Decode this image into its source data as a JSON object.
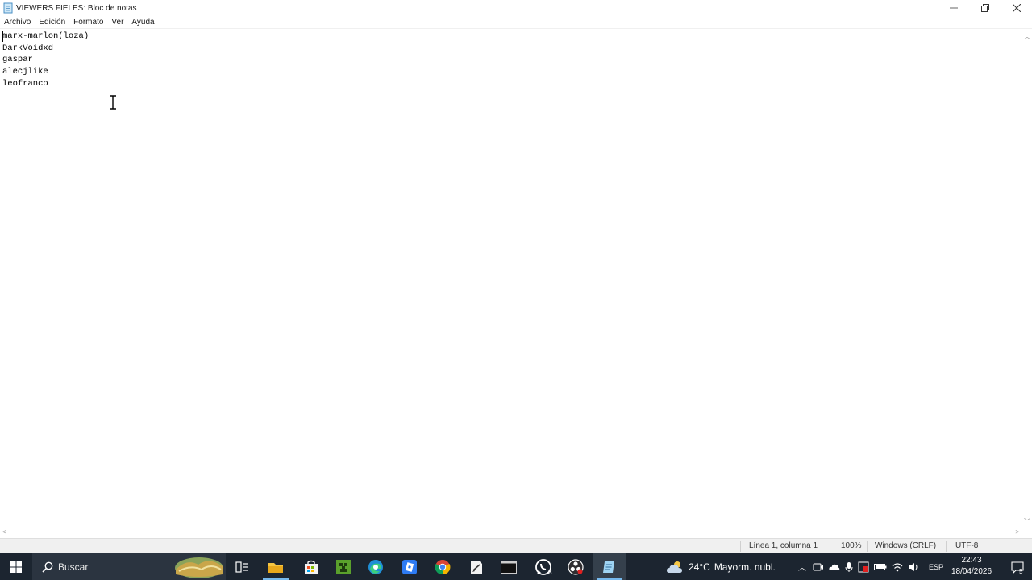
{
  "window": {
    "title": "VIEWERS FIELES: Bloc de notas",
    "icon": "notepad-icon"
  },
  "menu": [
    "Archivo",
    "Edición",
    "Formato",
    "Ver",
    "Ayuda"
  ],
  "editor": {
    "lines": [
      "marx-marlon(loza)",
      "DarkVoidxd",
      "gaspar",
      "alecjlike",
      "leofranco"
    ]
  },
  "status": {
    "position": "Línea 1, columna 1",
    "zoom": "100%",
    "line_ending": "Windows (CRLF)",
    "encoding": "UTF-8"
  },
  "taskbar": {
    "search_placeholder": "Buscar",
    "apps": [
      {
        "name": "task-view-icon"
      },
      {
        "name": "file-explorer-icon"
      },
      {
        "name": "store-icon",
        "badge": "1"
      },
      {
        "name": "minecraft-icon"
      },
      {
        "name": "edge-icon"
      },
      {
        "name": "roblox-icon"
      },
      {
        "name": "chrome-icon"
      },
      {
        "name": "files-icon"
      },
      {
        "name": "terminal-icon"
      },
      {
        "name": "whatsapp-icon",
        "badge": "8"
      },
      {
        "name": "obs-icon"
      },
      {
        "name": "notepad-icon"
      }
    ],
    "weather": {
      "temp": "24°C",
      "desc": "Mayorm. nubl."
    },
    "language": "ESP",
    "time": "22:43",
    "date": "18/04/2026",
    "notifications": "5"
  },
  "colors": {
    "taskbar_bg": "#1c2530",
    "active_indicator": "#76b9ed"
  }
}
